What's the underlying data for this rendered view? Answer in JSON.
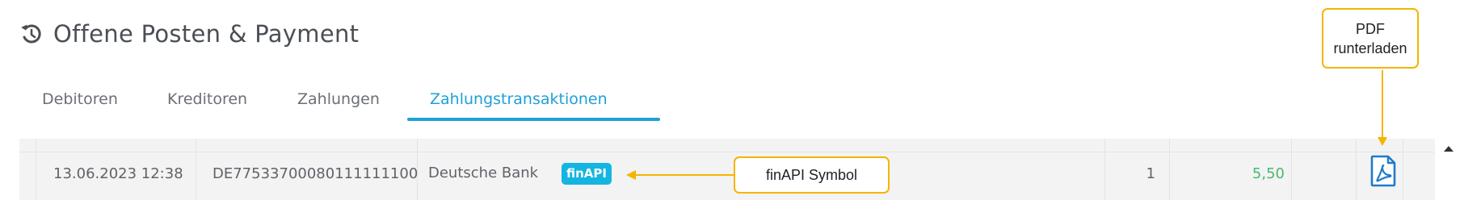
{
  "header": {
    "title": "Offene Posten & Payment",
    "icon": "history-icon"
  },
  "tabs": [
    {
      "label": "Debitoren",
      "active": false
    },
    {
      "label": "Kreditoren",
      "active": false
    },
    {
      "label": "Zahlungen",
      "active": false
    },
    {
      "label": "Zahlungstransaktionen",
      "active": true
    }
  ],
  "colors": {
    "accent": "#1fa0d6",
    "finapi_badge": "#14b5e0",
    "amount_positive": "#4cb86a",
    "annotation_border": "#f5b400"
  },
  "transactions": [
    {
      "datetime": "13.06.2023 12:38",
      "iban": "DE77533700080111111100",
      "bank": "Deutsche Bank",
      "badge": "finAPI",
      "count": "1",
      "amount": "5,50",
      "action_icon": "pdf-download-icon"
    }
  ],
  "annotations": {
    "pdf_callout_line1": "PDF",
    "pdf_callout_line2": "runterladen",
    "finapi_callout": "finAPI Symbol"
  }
}
